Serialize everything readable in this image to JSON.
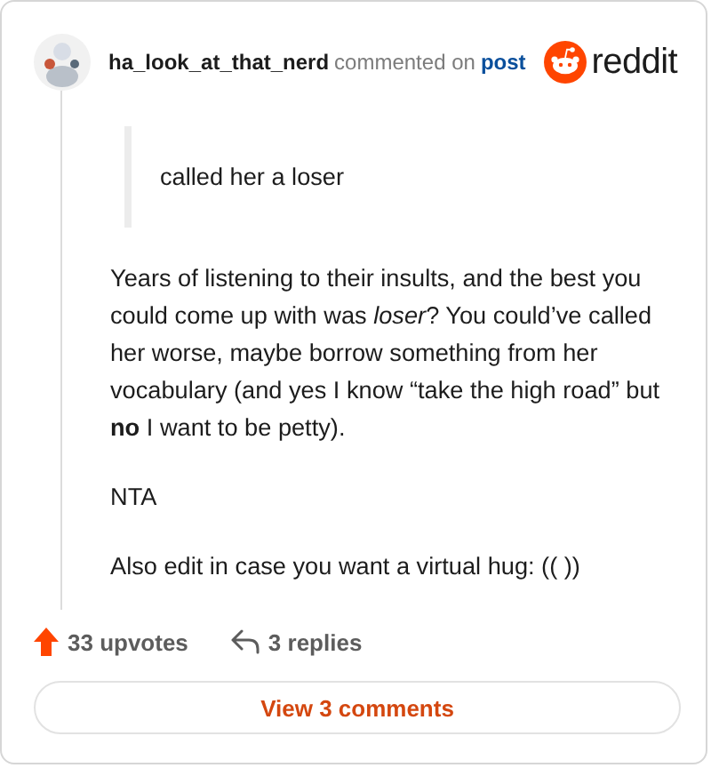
{
  "header": {
    "username": "ha_look_at_that_nerd",
    "action": "commented on",
    "link": "post",
    "brand": "reddit"
  },
  "quote": "called her a loser",
  "paragraphs": [
    "Years of listening to their insults, and the best you could come up with was *loser*? You could’ve called her worse, maybe borrow something from her vocabulary (and yes I know “take the high road” but **no** I want to be petty).",
    "NTA",
    "Also edit in case you want a virtual hug: (( ))"
  ],
  "footer": {
    "upvotes": "33 upvotes",
    "replies": "3 replies"
  },
  "button": "View 3 comments"
}
